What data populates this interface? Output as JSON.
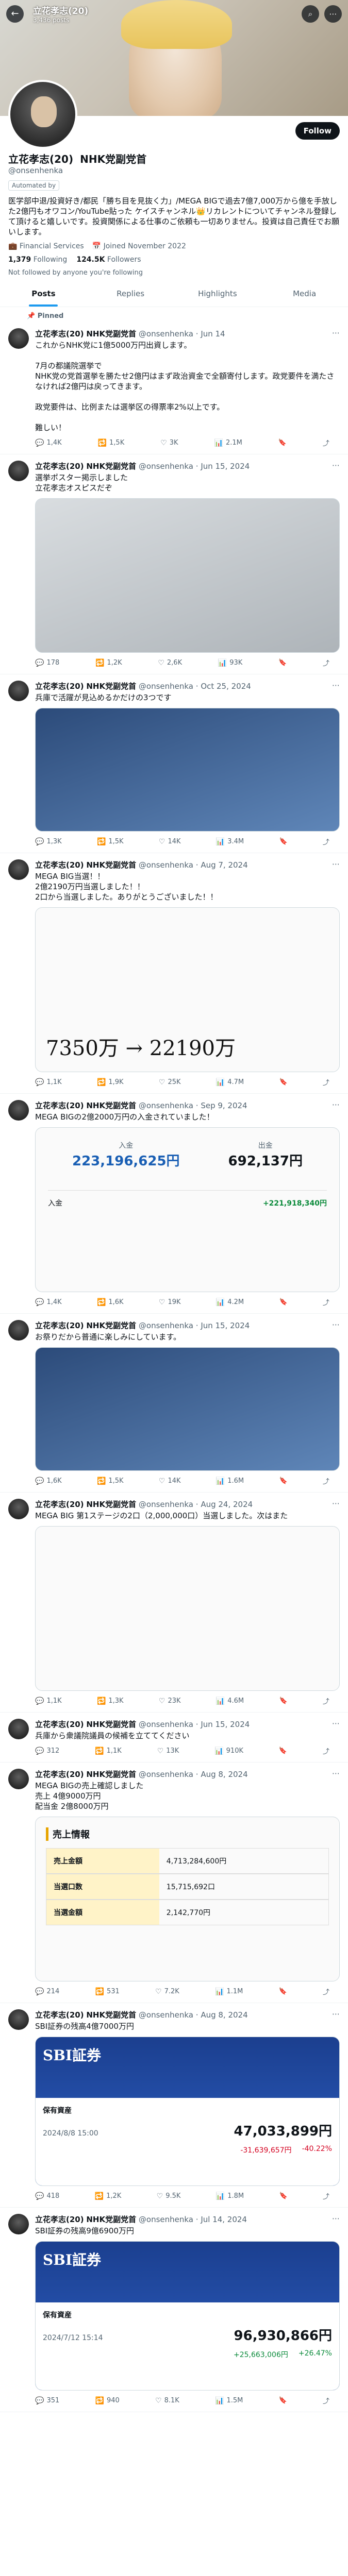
{
  "header": {
    "name": "立花孝志(20)",
    "subtitle": "NHK党副党首",
    "posts_count": "3,436 posts"
  },
  "profile": {
    "name": "立花孝志(20)",
    "tagline": "NHK党副党首",
    "handle": "@onsenhenka",
    "follow_label": "Follow",
    "chip": "Automated by",
    "bio": "医学部中退/投資好き/都民「勝ち目を見抜く力」/MEGA BIGで過去7億7,000万から億を手放した2億円もオワコン/YouTube貼った ケイスチャンネル👑リカレントについてチャンネル登録して頂けると嬉しいです。投資関係による仕事のご依頼も一切ありません。投資は自己責任でお願いします。",
    "meta_financial": "Financial Services",
    "meta_joined": "Joined November 2022",
    "following_count": "1,379",
    "following_label": "Following",
    "followers_count": "124.5K",
    "followers_label": "Followers",
    "followed_note": "Not followed by anyone you're following"
  },
  "tabs": [
    "Posts",
    "Replies",
    "Highlights",
    "Media"
  ],
  "posts": [
    {
      "pinned": "Pinned",
      "name": "立花孝志(20)",
      "badge": "NHK党副党首",
      "handle": "@onsenhenka",
      "date": "Jun 14",
      "text": "これからNHK党に1億5000万円出資します。\n\n7月の都議院選挙で\nNHK党の党首選挙を勝たせ2億円はまず政治資金で全額寄付します。政党要件を満たさなければ2億円は戻ってきます。\n\n政党要件は、比例または選挙区の得票率2%以上です。\n\n難しい！",
      "media": "",
      "stats": {
        "reply": "1,4K",
        "repost": "1,5K",
        "like": "3K",
        "views": "2.1M"
      }
    },
    {
      "pinned": "",
      "name": "立花孝志(20)",
      "badge": "NHK党副党首",
      "handle": "@onsenhenka",
      "date": "Jun 15, 2024",
      "text": "選挙ポスター掲示しました\n立花孝志オスピスだぞ",
      "media": "gray",
      "stats": {
        "reply": "178",
        "repost": "1,2K",
        "like": "2,6K",
        "views": "93K"
      }
    },
    {
      "pinned": "",
      "name": "立花孝志(20)",
      "badge": "NHK党副党首",
      "handle": "@onsenhenka",
      "date": "Oct 25, 2024",
      "text": "兵庫で活躍が見込めるかだけの3つです",
      "media": "news",
      "stats": {
        "reply": "1,3K",
        "repost": "1,5K",
        "like": "14K",
        "views": "3.4M"
      }
    },
    {
      "pinned": "",
      "name": "立花孝志(20)",
      "badge": "NHK党副党首",
      "handle": "@onsenhenka",
      "date": "Aug 7, 2024",
      "text": "MEGA BIG当選！！\n2億2190万円当選しました！！\n2口から当選しました。ありがとうございました！！",
      "media": "white",
      "stats": {
        "reply": "1,1K",
        "repost": "1,9K",
        "like": "25K",
        "views": "4.7M"
      }
    },
    {
      "pinned": "",
      "name": "立花孝志(20)",
      "badge": "NHK党副党首",
      "handle": "@onsenhenka",
      "date": "Sep 9, 2024",
      "text": "MEGA BIGの2億2000万円の入金されていました！",
      "media": "white",
      "stats": {
        "reply": "1,4K",
        "repost": "1,6K",
        "like": "19K",
        "views": "4.2M"
      }
    },
    {
      "pinned": "",
      "name": "立花孝志(20)",
      "badge": "NHK党副党首",
      "handle": "@onsenhenka",
      "date": "Jun 15, 2024",
      "text": "お祭りだから普通に楽しみにしています。",
      "media": "news",
      "stats": {
        "reply": "1,6K",
        "repost": "1,5K",
        "like": "14K",
        "views": "1.6M"
      }
    },
    {
      "pinned": "",
      "name": "立花孝志(20)",
      "badge": "NHK党副党首",
      "handle": "@onsenhenka",
      "date": "Aug 24, 2024",
      "text": "MEGA BIG 第1ステージの2口（2,000,000口）当選しました。次はまた",
      "media": "white",
      "stats": {
        "reply": "1,1K",
        "repost": "1,3K",
        "like": "23K",
        "views": "4.6M"
      }
    },
    {
      "pinned": "",
      "name": "立花孝志(20)",
      "badge": "NHK党副党首",
      "handle": "@onsenhenka",
      "date": "Jun 15, 2024",
      "text": "兵庫から衆議院議員の候補を立ててください",
      "media": "",
      "stats": {
        "reply": "312",
        "repost": "1,1K",
        "like": "13K",
        "views": "910K"
      }
    },
    {
      "pinned": "",
      "name": "立花孝志(20)",
      "badge": "NHK党副党首",
      "handle": "@onsenhenka",
      "date": "Aug 8, 2024",
      "text": "MEGA BIGの売上確認しました\n売上 4億9000万円\n配当金 2億8000万円",
      "media": "white",
      "stats": {
        "reply": "214",
        "repost": "531",
        "like": "7.2K",
        "views": "1.1M"
      }
    },
    {
      "pinned": "",
      "name": "立花孝志(20)",
      "badge": "NHK党副党首",
      "handle": "@onsenhenka",
      "date": "Aug 8, 2024",
      "text": "SBI証券の残高4億7000万円",
      "media": "blue",
      "stats": {
        "reply": "418",
        "repost": "1,2K",
        "like": "9.5K",
        "views": "1.8M"
      }
    },
    {
      "pinned": "",
      "name": "立花孝志(20)",
      "badge": "NHK党副党首",
      "handle": "@onsenhenka",
      "date": "Jul 14, 2024",
      "text": "SBI証券の残高9億6900万円",
      "media": "blue",
      "stats": {
        "reply": "351",
        "repost": "940",
        "like": "8.1K",
        "views": "1.5M"
      }
    }
  ],
  "media_text": {
    "chart1": {
      "title": "入金",
      "amount1": "223,196,625円",
      "label2": "出金",
      "amount2": "692,137円",
      "row_label": "入金",
      "row_value": "+221,918,340円"
    },
    "lotto": {
      "big_left": "7350万",
      "arrow": "→",
      "big_right": "22190万"
    },
    "sbi1": {
      "brand": "SBI証券",
      "section": "保有資産",
      "date": "2024/8/8 15:00",
      "total": "47,033,899円",
      "pl": "-31,639,657円",
      "pct": "-40.22%"
    },
    "sbi2": {
      "brand": "SBI証券",
      "section": "保有資産",
      "date": "2024/7/12 15:14",
      "total": "96,930,866円",
      "pl": "+25,663,006円",
      "pct": "+26.47%"
    },
    "sales": {
      "title": "売上情報",
      "r1_label": "売上金額",
      "r1_value": "4,713,284,600円",
      "r2_label": "当選口数",
      "r2_value": "15,715,692口",
      "r3_label": "当選金額",
      "r3_value": "2,142,770円"
    }
  }
}
